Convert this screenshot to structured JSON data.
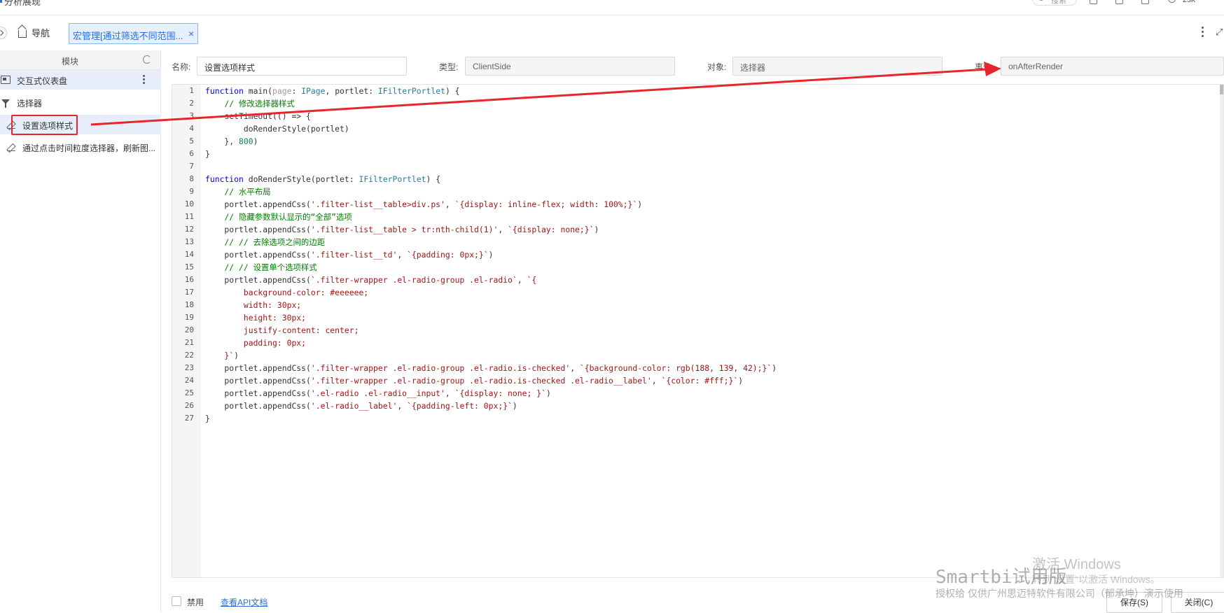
{
  "app": {
    "title": "分析展现"
  },
  "topbar": {
    "search_label": "搜索",
    "user": "zsk"
  },
  "tabs": {
    "nav_label": "导航",
    "active_label": "宏管理[通过筛选不同范围...",
    "close_glyph": "×"
  },
  "left_panel": {
    "header": "模块",
    "items": [
      {
        "label": "交互式仪表盘",
        "icon": "dashboard-icon"
      },
      {
        "label": "选择器",
        "icon": "filter-icon"
      },
      {
        "label": "设置选项样式",
        "icon": "pencil-icon",
        "selected": true
      },
      {
        "label": "通过点击时间粒度选择器，刷新图...",
        "icon": "pencil-icon"
      }
    ]
  },
  "form": {
    "name_label": "名称:",
    "name_value": "设置选项样式",
    "type_label": "类型:",
    "type_value": "ClientSide",
    "object_label": "对象:",
    "object_value": "选择器",
    "event_label": "事件:",
    "event_value": "onAfterRender"
  },
  "editor": {
    "line_numbers": [
      "1",
      "2",
      "3",
      "4",
      "5",
      "6",
      "7",
      "8",
      "9",
      "10",
      "11",
      "12",
      "13",
      "14",
      "15",
      "16",
      "17",
      "18",
      "19",
      "20",
      "21",
      "22",
      "23",
      "24",
      "25",
      "26",
      "27"
    ]
  },
  "footer": {
    "disable_label": "禁用",
    "api_link": "查看API文档",
    "save_label": "保存(S)",
    "close_label": "关闭(C)"
  },
  "watermarks": {
    "windows_title": "激活 Windows",
    "windows_sub": "转到\"设置\"以激活 Windows。",
    "trial": "Smartbi试用版",
    "license": "授权给 仅供广州思迈特软件有限公司（郁承坤）演示使用"
  },
  "colors": {
    "accent": "#2c6ed6",
    "annotation_red": "#e8262a",
    "code_keyword": "#0000ff",
    "code_comment": "#008000",
    "code_string": "#a31515",
    "code_type": "#267f99",
    "code_number": "#098658"
  }
}
